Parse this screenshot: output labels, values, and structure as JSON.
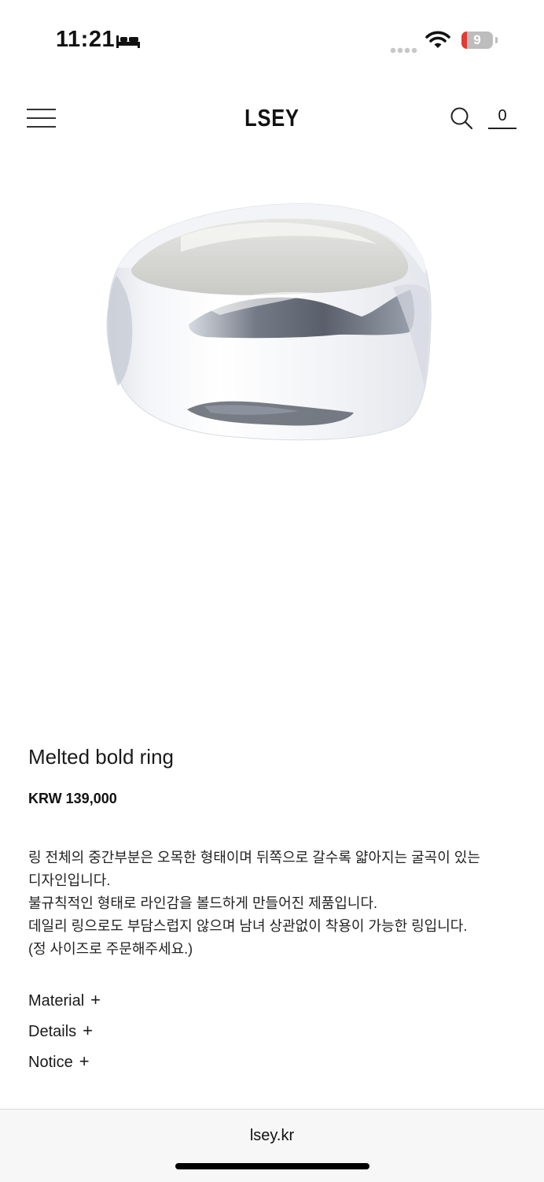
{
  "status_bar": {
    "time": "11:21",
    "battery_level": "9",
    "battery_fraction": 0.09,
    "icons": [
      "bed-icon",
      "cellular-signal-icon",
      "wifi-icon",
      "battery-icon"
    ]
  },
  "header": {
    "logo": "LSEY",
    "cart_count": "0",
    "icons": [
      "menu-icon",
      "search-icon"
    ]
  },
  "product": {
    "image": "silver-melted-bold-ring",
    "name": "Melted bold ring",
    "price": "KRW 139,000",
    "description": [
      "링 전체의 중간부분은 오목한 형태이며 뒤쪽으로 갈수록 얇아지는 굴곡이 있는",
      "디자인입니다.",
      "불규칙적인 형태로 라인감을 볼드하게 만들어진 제품입니다.",
      "데일리 링으로도 부담스럽지 않으며 남녀 상관없이 착용이 가능한 링입니다.",
      "(정 사이즈로 주문해주세요.)"
    ]
  },
  "accordions": [
    {
      "label": "Material",
      "icon": "+"
    },
    {
      "label": "Details",
      "icon": "+"
    },
    {
      "label": "Notice",
      "icon": "+"
    }
  ],
  "browser": {
    "url": "lsey.kr"
  },
  "colors": {
    "background": "#ffffff",
    "text": "#111111",
    "battery_low": "#e53935",
    "bottom_bar": "#f7f7f7"
  }
}
